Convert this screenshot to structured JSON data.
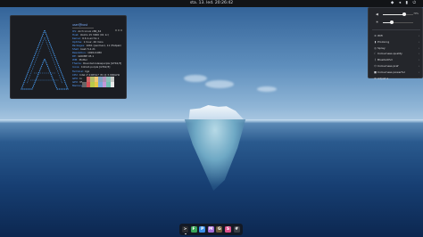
{
  "topbar": {
    "clock": "sta. 13. led. 20:26:42",
    "tray_icons": [
      "network-icon",
      "volume-icon",
      "battery-icon",
      "power-icon"
    ]
  },
  "terminal": {
    "userhost": "user@host",
    "rows": [
      {
        "key": "OS:",
        "value": "Arch Linux x86_64"
      },
      {
        "key": "Host:",
        "value": "Vostro 15 3000 (01 1c)"
      },
      {
        "key": "Kernel:",
        "value": "6.6.1-arch1-1"
      },
      {
        "key": "Uptime:",
        "value": "1 hour, 26 mins"
      },
      {
        "key": "Packages:",
        "value": "1061 (pacman), 11 (flatpak)"
      },
      {
        "key": "Shell:",
        "value": "bash 5.2.21"
      },
      {
        "key": "Resolution:",
        "value": "1920x1080"
      },
      {
        "key": "DE:",
        "value": "GNOME 45.1"
      },
      {
        "key": "WM:",
        "value": "Mutter"
      },
      {
        "key": "Theme:",
        "value": "Rounded-Glasspurple [GTK2/3]"
      },
      {
        "key": "Icons:",
        "value": "Colloid-purple [GTK2/3]"
      },
      {
        "key": "Terminal:",
        "value": "kgx"
      },
      {
        "key": "CPU:",
        "value": "Intel i7-1065G7 (8) @ 3.900GHz"
      },
      {
        "key": "GPU:",
        "value": "Intel Iris Plus Graphics G7"
      },
      {
        "key": "GPU:",
        "value": "NVIDIA GeForce MX230"
      },
      {
        "key": "Memory:",
        "value": "2238MiB / 15795MiB"
      }
    ],
    "palette": [
      "#1d1f21",
      "#cc6666",
      "#b5bd68",
      "#f0c674",
      "#81a2be",
      "#b294bb",
      "#8abeb7",
      "#c5c8c6",
      "#666666",
      "#d54e53",
      "#b9ca4a",
      "#e7c547",
      "#7aa6da",
      "#c397d8",
      "#70c0b1",
      "#eaeaea"
    ]
  },
  "quick_settings": {
    "volume": {
      "icon": "speaker-icon",
      "level": 0.7,
      "label": "70%"
    },
    "brightness": {
      "icon": "sun-icon",
      "level": 0.3,
      "label": ""
    },
    "items": [
      {
        "icon": "wifi-icon",
        "label": "Wifi"
      },
      {
        "icon": "battery-icon",
        "label": "Prolonng"
      },
      {
        "icon": "globe-icon",
        "label": "Spray"
      },
      {
        "icon": "moon-icon",
        "label": "Colourness quality"
      },
      {
        "icon": "bluetooth-icon",
        "label": "Bluetoothd"
      },
      {
        "icon": "power-icon",
        "label": "Colourness pref"
      },
      {
        "icon": "lock-icon",
        "label": "Colourness powerful"
      },
      {
        "icon": "settings-icon",
        "label": "Adjust a"
      }
    ]
  },
  "dock": {
    "apps": [
      {
        "name": "terminal",
        "glyph": ">",
        "color": "#2b2d31"
      },
      {
        "name": "files",
        "glyph": "F",
        "color": "#3aa657"
      },
      {
        "name": "photos",
        "glyph": "P",
        "color": "#3a8ee6"
      },
      {
        "name": "music",
        "glyph": "M",
        "color": "#a56bd6"
      },
      {
        "name": "gimp",
        "glyph": "G",
        "color": "#6b5b3a"
      },
      {
        "name": "store",
        "glyph": "S",
        "color": "#e0508a"
      },
      {
        "name": "grid",
        "glyph": "#",
        "color": "#3b3e45"
      }
    ]
  }
}
